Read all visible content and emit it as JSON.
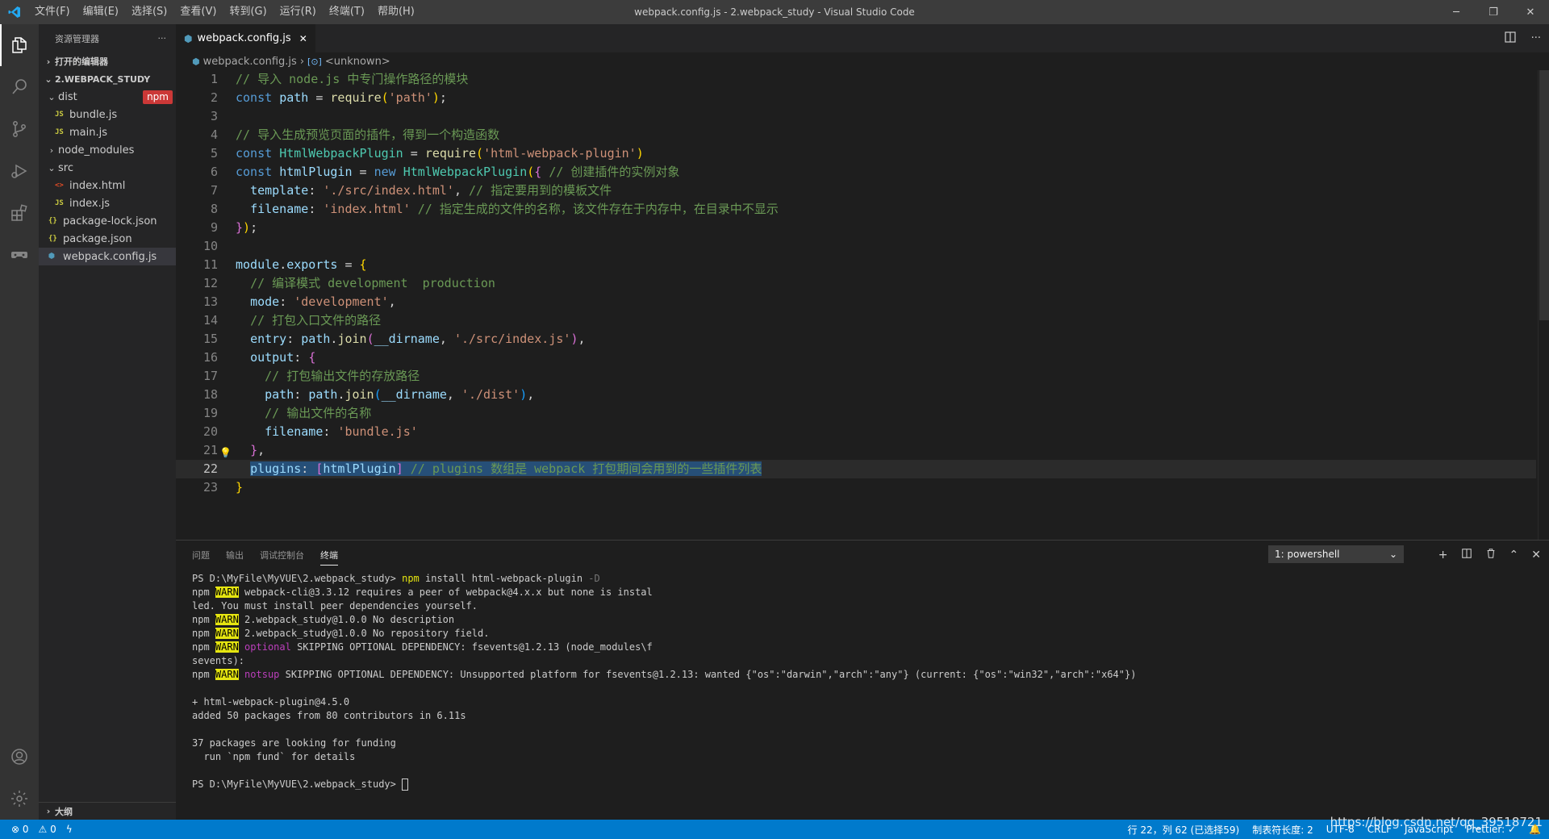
{
  "window": {
    "title": "webpack.config.js - 2.webpack_study - Visual Studio Code",
    "menu": [
      "文件(F)",
      "编辑(E)",
      "选择(S)",
      "查看(V)",
      "转到(G)",
      "运行(R)",
      "终端(T)",
      "帮助(H)"
    ],
    "controls": {
      "minimize": "─",
      "restore": "❐",
      "close": "✕"
    }
  },
  "activity_bar": {
    "items": [
      "explorer-icon",
      "search-icon",
      "source-control-icon",
      "run-debug-icon",
      "extensions-icon",
      "remote-icon"
    ],
    "bottom": [
      "account-icon",
      "settings-gear-icon"
    ]
  },
  "sidebar": {
    "title": "资源管理器",
    "more": "···",
    "open_editors": "打开的编辑器",
    "project": "2.WEBPACK_STUDY",
    "tree": [
      {
        "label": "dist",
        "type": "folder",
        "open": true,
        "depth": 0,
        "badge": "npm"
      },
      {
        "label": "bundle.js",
        "type": "js",
        "depth": 1
      },
      {
        "label": "main.js",
        "type": "js",
        "depth": 1
      },
      {
        "label": "node_modules",
        "type": "folder",
        "open": false,
        "depth": 0
      },
      {
        "label": "src",
        "type": "folder",
        "open": true,
        "depth": 0
      },
      {
        "label": "index.html",
        "type": "html",
        "depth": 1
      },
      {
        "label": "index.js",
        "type": "js",
        "depth": 1
      },
      {
        "label": "package-lock.json",
        "type": "json",
        "depth": 0
      },
      {
        "label": "package.json",
        "type": "json",
        "depth": 0
      },
      {
        "label": "webpack.config.js",
        "type": "webpack",
        "depth": 0,
        "selected": true
      }
    ],
    "outline": "大纲"
  },
  "editor": {
    "tab_label": "webpack.config.js",
    "tab_close": "✕",
    "breadcrumb": [
      "webpack.config.js",
      "<unknown>"
    ],
    "current_line": 22
  },
  "panel": {
    "tabs": [
      "问题",
      "输出",
      "调试控制台",
      "终端"
    ],
    "active_tab": "终端",
    "terminal_select": "1: powershell",
    "actions": {
      "add": "+",
      "split": "⫿",
      "trash": "🗑",
      "maximize": "⌃",
      "close": "✕"
    }
  },
  "statusbar": {
    "errors": "⊗ 0",
    "warnings": "⚠ 0",
    "position": "行 22，列 62 (已选择59)",
    "tab_size": "制表符长度: 2",
    "encoding": "UTF-8",
    "eol": "CRLF",
    "language": "JavaScript",
    "formatter": "Prettier: ✓"
  },
  "watermark": "https://blog.csdn.net/qq_39518721",
  "colors": {
    "accent": "#007acc",
    "npm": "#cb3837",
    "js_icon": "#cbcb41",
    "json_icon": "#cbcb41",
    "html_icon": "#e44d26",
    "webpack_icon": "#519aba"
  }
}
